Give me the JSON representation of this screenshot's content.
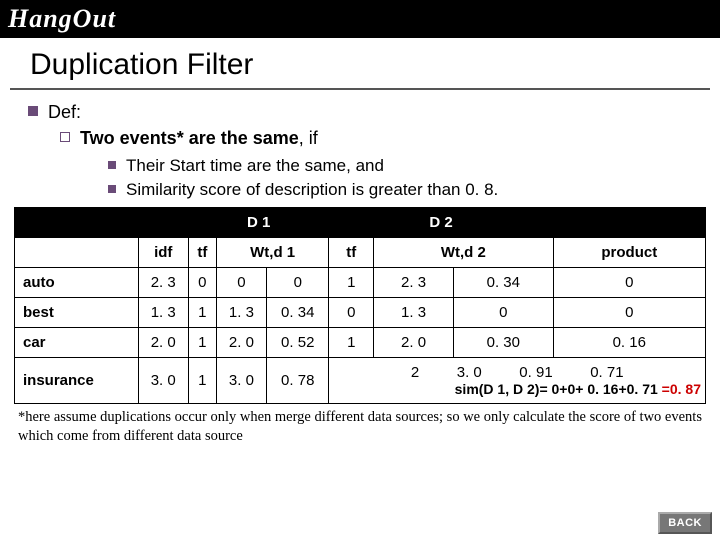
{
  "logo": "HangOut",
  "title": "Duplication Filter",
  "def_label": "Def:",
  "same_prefix": "Two events* are the same",
  "same_suffix": ", if",
  "cond1": "Their Start time are the same, and",
  "cond2": "Similarity score of description is greater than 0. 8.",
  "headers": {
    "d1": "D 1",
    "d2": "D 2",
    "idf": "idf",
    "tf": "tf",
    "wtd1": "Wt,d 1",
    "wtd2": "Wt,d 2",
    "product": "product"
  },
  "rows": [
    {
      "term": "auto",
      "idf": "2. 3",
      "tf1": "0",
      "t1a": "0",
      "wtd1": "0",
      "tf2": "1",
      "t2a": "2. 3",
      "wtd2": "0. 34",
      "product": "0"
    },
    {
      "term": "best",
      "idf": "1. 3",
      "tf1": "1",
      "t1a": "1. 3",
      "wtd1": "0. 34",
      "tf2": "0",
      "t2a": "1. 3",
      "wtd2": "0",
      "product": "0"
    },
    {
      "term": "car",
      "idf": "2. 0",
      "tf1": "1",
      "t1a": "2. 0",
      "wtd1": "0. 52",
      "tf2": "1",
      "t2a": "2. 0",
      "wtd2": "0. 30",
      "product": "0. 16"
    },
    {
      "term": "insurance",
      "idf": "3. 0",
      "tf1": "1",
      "t1a": "3. 0",
      "wtd1": "0. 78",
      "tf2": "2",
      "t2a": "3. 0",
      "wtd2": "0. 91",
      "product": "0. 71"
    }
  ],
  "sim_black": "sim(D 1, D 2)= 0+0+ 0. 16+0. 71 ",
  "sim_red": "=0. 87",
  "footnote": "*here assume duplications occur only when merge different data sources; so we only calculate the score of two events which come from different data source",
  "back": "BACK"
}
